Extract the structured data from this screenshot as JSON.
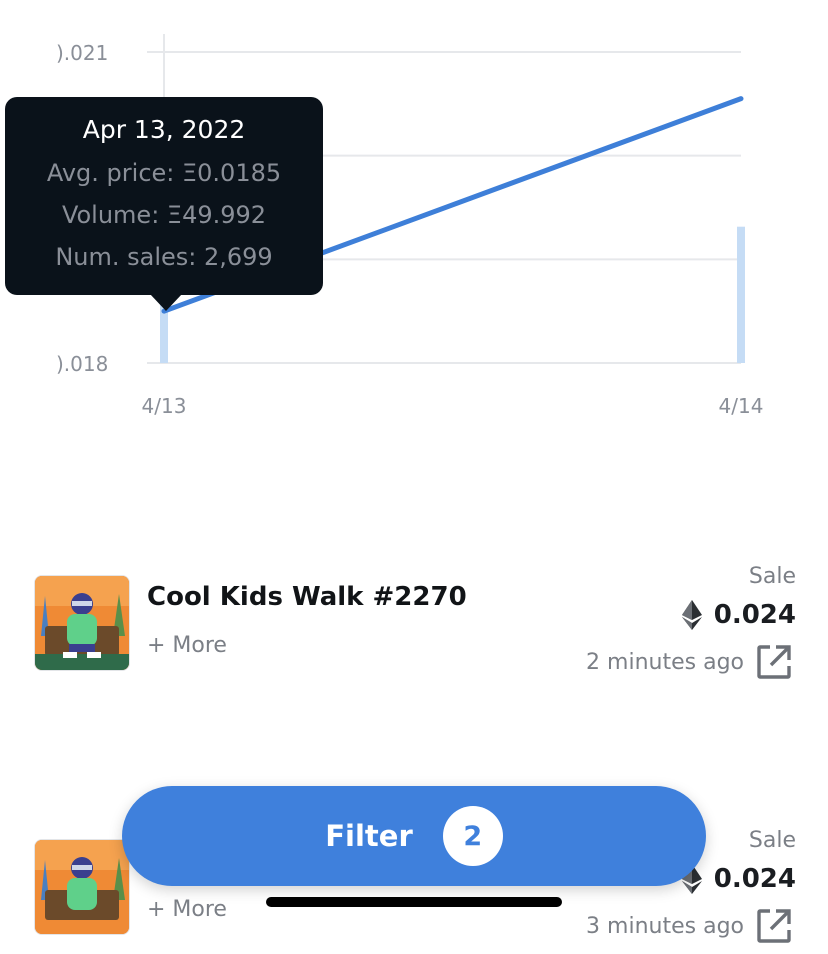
{
  "chart_data": {
    "type": "line",
    "x": [
      "4/13",
      "4/14"
    ],
    "series": [
      {
        "values": [
          0.0185,
          0.02055
        ]
      }
    ],
    "volume_bars": [
      49.992,
      58
    ],
    "y_tick_labels": [
      ").021",
      ").018"
    ],
    "ylim": [
      0.018,
      0.021
    ],
    "grid": true,
    "line_color": "#3e7fd8",
    "bar_color": "#c5dcf5"
  },
  "tooltip": {
    "date": "Apr 13, 2022",
    "avg_price": "Avg. price: Ξ0.0185",
    "volume": "Volume: Ξ49.992",
    "num_sales": "Num. sales: 2,699"
  },
  "sales": [
    {
      "name": "Cool Kids Walk #2270",
      "more": "+ More",
      "type": "Sale",
      "price": "0.024",
      "time": "2 minutes ago",
      "currency_icon": "ethereum-icon",
      "link_icon": "external-link-icon"
    },
    {
      "name": "",
      "more": "+ More",
      "type": "Sale",
      "price": "0.024",
      "time": "3 minutes ago",
      "currency_icon": "ethereum-icon",
      "link_icon": "external-link-icon"
    }
  ],
  "filter": {
    "label": "Filter",
    "count": "2"
  },
  "colors": {
    "accent": "#3f80dc",
    "tooltip_bg": "#0a121a"
  }
}
